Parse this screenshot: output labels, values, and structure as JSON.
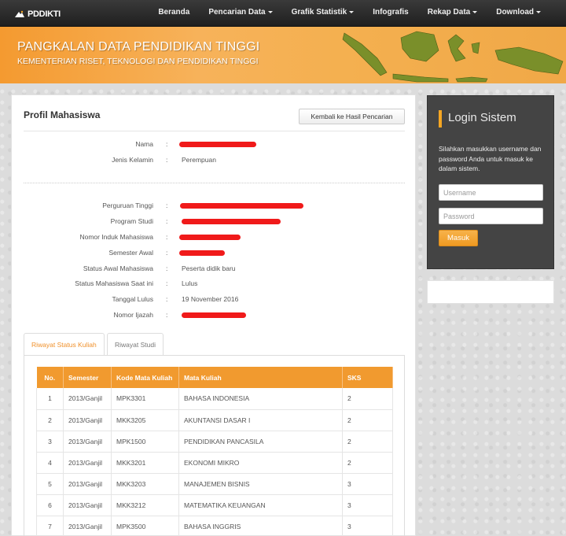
{
  "navbar": {
    "logo_text": "PDDIKTI",
    "items": [
      {
        "label": "Beranda",
        "dropdown": false
      },
      {
        "label": "Pencarian Data",
        "dropdown": true
      },
      {
        "label": "Grafik Statistik",
        "dropdown": true
      },
      {
        "label": "Infografis",
        "dropdown": false
      },
      {
        "label": "Rekap Data",
        "dropdown": true
      },
      {
        "label": "Download",
        "dropdown": true
      }
    ]
  },
  "banner": {
    "title": "PANGKALAN DATA PENDIDIKAN TINGGI",
    "subtitle": "KEMENTERIAN RISET, TEKNOLOGI DAN PENDIDIKAN TINGGI"
  },
  "profile": {
    "title": "Profil Mahasiswa",
    "back_button": "Kembali ke Hasil Pencarian",
    "fields": [
      {
        "label": "Nama",
        "value": "",
        "redacted": true
      },
      {
        "label": "Jenis Kelamin",
        "value": "Perempuan",
        "redacted": false
      },
      {
        "label": "Perguruan Tinggi",
        "value": "",
        "redacted": true
      },
      {
        "label": "Program Studi",
        "value": "",
        "redacted": true
      },
      {
        "label": "Nomor Induk Mahasiswa",
        "value": "",
        "redacted": true
      },
      {
        "label": "Semester Awal",
        "value": "",
        "redacted": true
      },
      {
        "label": "Status Awal Mahasiswa",
        "value": "Peserta didik baru",
        "redacted": false
      },
      {
        "label": "Status Mahasiswa Saat ini",
        "value": "Lulus",
        "redacted": false
      },
      {
        "label": "Tanggal Lulus",
        "value": "19 November 2016",
        "redacted": false
      },
      {
        "label": "Nomor Ijazah",
        "value": "",
        "redacted": true
      }
    ],
    "colon": ":"
  },
  "tabs": [
    {
      "label": "Riwayat Status Kuliah",
      "active": true
    },
    {
      "label": "Riwayat Studi",
      "active": false
    }
  ],
  "table": {
    "headers": [
      "No.",
      "Semester",
      "Kode Mata Kuliah",
      "Mata Kuliah",
      "SKS"
    ],
    "rows": [
      [
        "1",
        "2013/Ganjil",
        "MPK3301",
        "BAHASA INDONESIA",
        "2"
      ],
      [
        "2",
        "2013/Ganjil",
        "MKK3205",
        "AKUNTANSI DASAR I",
        "2"
      ],
      [
        "3",
        "2013/Ganjil",
        "MPK1500",
        "PENDIDIKAN PANCASILA",
        "2"
      ],
      [
        "4",
        "2013/Ganjil",
        "MKK3201",
        "EKONOMI MIKRO",
        "2"
      ],
      [
        "5",
        "2013/Ganjil",
        "MKK3203",
        "MANAJEMEN BISNIS",
        "3"
      ],
      [
        "6",
        "2013/Ganjil",
        "MKK3212",
        "MATEMATIKA KEUANGAN",
        "3"
      ],
      [
        "7",
        "2013/Ganjil",
        "MPK3500",
        "BAHASA INGGRIS",
        "3"
      ]
    ]
  },
  "login": {
    "title": "Login Sistem",
    "description": "Silahkan masukkan username dan password Anda untuk masuk ke dalam sistem.",
    "username_placeholder": "Username",
    "password_placeholder": "Password",
    "submit_label": "Masuk"
  },
  "colors": {
    "accent": "#f19a2f",
    "redaction": "#f01a1a",
    "navbar": "#2b2b2b",
    "sidebar": "#444444"
  }
}
